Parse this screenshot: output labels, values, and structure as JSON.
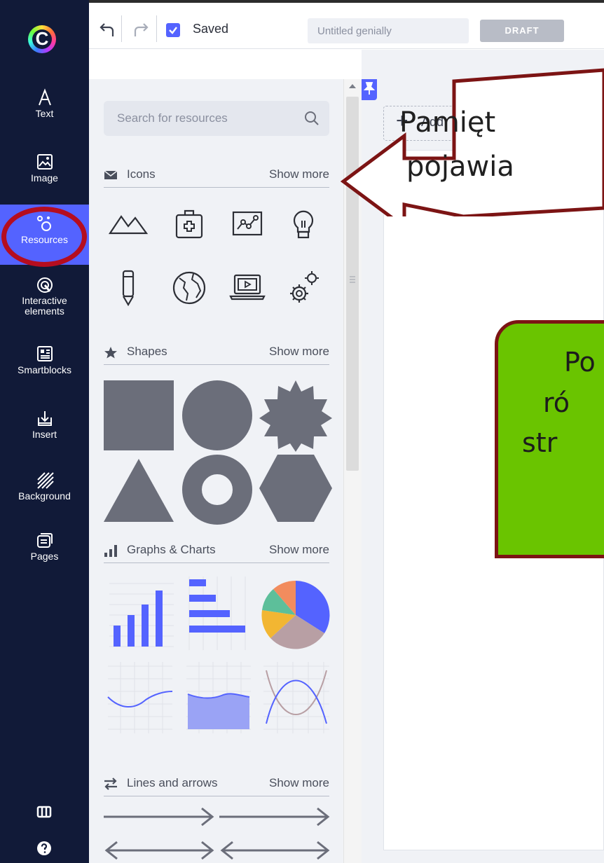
{
  "sidebar": {
    "logo_letter": "C",
    "items": [
      {
        "label": "Text",
        "icon": "text-icon"
      },
      {
        "label": "Image",
        "icon": "image-icon"
      },
      {
        "label": "Resources",
        "icon": "resources-icon",
        "active": true
      },
      {
        "label": "Interactive elements",
        "icon": "interactive-icon"
      },
      {
        "label": "Smartblocks",
        "icon": "smartblocks-icon"
      },
      {
        "label": "Insert",
        "icon": "insert-icon"
      },
      {
        "label": "Background",
        "icon": "background-icon"
      },
      {
        "label": "Pages",
        "icon": "pages-icon"
      }
    ],
    "bottom_icons": [
      "gift-icon",
      "help-icon"
    ],
    "accent": "#5463ff",
    "bg": "#111a38"
  },
  "topbar": {
    "saved_label": "Saved",
    "title_placeholder": "Untitled genially",
    "status_badge": "DRAFT"
  },
  "panel": {
    "search_placeholder": "Search for resources",
    "sections": {
      "icons": {
        "title": "Icons",
        "more": "Show more",
        "items": [
          "mountain-icon",
          "first-aid-kit-icon",
          "graph-frame-icon",
          "lightbulb-icon",
          "pencil-icon",
          "globe-icon",
          "laptop-video-icon",
          "gears-icon"
        ]
      },
      "shapes": {
        "title": "Shapes",
        "more": "Show more",
        "items": [
          "square",
          "circle",
          "starburst",
          "triangle",
          "ring",
          "hexagon"
        ],
        "color": "#6b6e7a"
      },
      "graphs": {
        "title": "Graphs & Charts",
        "more": "Show more",
        "items": [
          "vertical-bar-chart",
          "horizontal-bar-chart",
          "pie-chart",
          "line-chart",
          "area-chart",
          "crossing-curves-chart"
        ]
      },
      "lines": {
        "title": "Lines and arrows",
        "more": "Show more",
        "items": [
          "arrow-right",
          "arrow-right-long",
          "arrow-both",
          "arrow-both-long"
        ]
      }
    }
  },
  "canvas": {
    "add_label": "Add"
  },
  "callouts": {
    "arrow_line1": "Pamięt",
    "arrow_line2": "pojawia",
    "green_line1": "Po",
    "green_line2": "ró",
    "green_line3": "str",
    "green_color": "#6ac400",
    "border_color": "#7c1414"
  }
}
